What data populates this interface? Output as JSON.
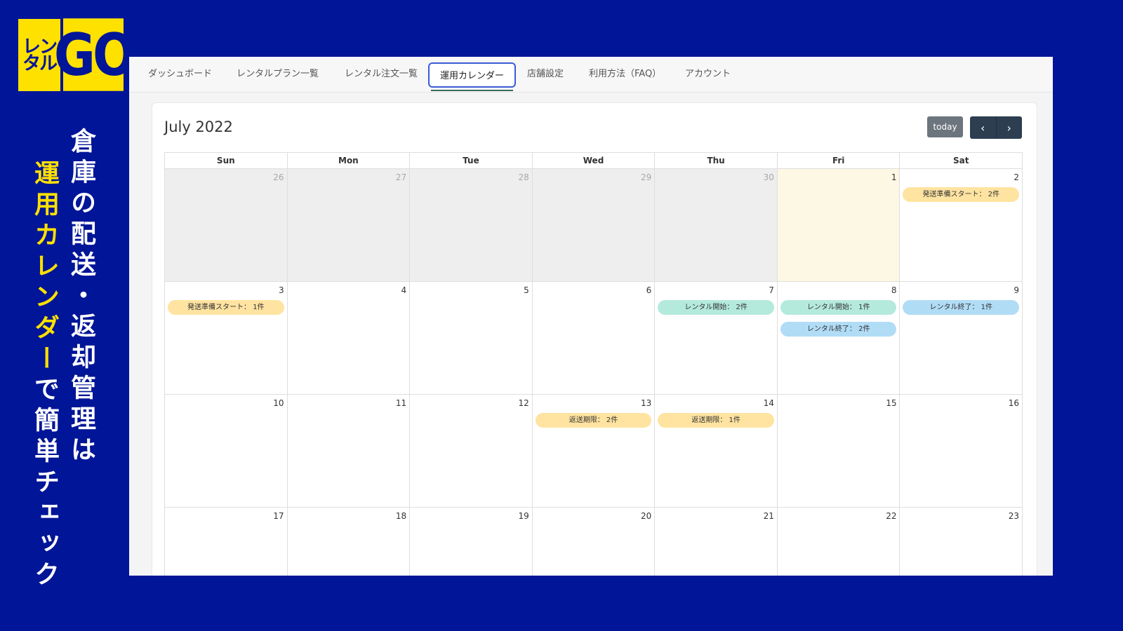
{
  "logo": {
    "left_line1": "レン",
    "left_line2": "タル",
    "right": "GO"
  },
  "tagline": {
    "line1": "倉庫の配送・返却管理は",
    "line2_highlight": "運用カレンダー",
    "line2_rest": "で簡単チェック"
  },
  "nav": {
    "tabs": [
      {
        "label": "ダッシュボード",
        "active": false
      },
      {
        "label": "レンタルプラン一覧",
        "active": false
      },
      {
        "label": "レンタル注文一覧",
        "active": false
      },
      {
        "label": "運用カレンダー",
        "active": true
      },
      {
        "label": "店舗設定",
        "active": false
      },
      {
        "label": "利用方法（FAQ）",
        "active": false
      },
      {
        "label": "アカウント",
        "active": false
      }
    ]
  },
  "calendar": {
    "title": "July 2022",
    "today_label": "today",
    "prev_icon": "chevron-left-icon",
    "next_icon": "chevron-right-icon",
    "weekdays": [
      "Sun",
      "Mon",
      "Tue",
      "Wed",
      "Thu",
      "Fri",
      "Sat"
    ],
    "weeks": [
      [
        {
          "day": "26",
          "other": true
        },
        {
          "day": "27",
          "other": true
        },
        {
          "day": "28",
          "other": true
        },
        {
          "day": "29",
          "other": true
        },
        {
          "day": "30",
          "other": true
        },
        {
          "day": "1",
          "today": true
        },
        {
          "day": "2",
          "events": [
            {
              "label": "発送準備スタート： 2件",
              "kind": "prep"
            }
          ]
        }
      ],
      [
        {
          "day": "3",
          "events": [
            {
              "label": "発送準備スタート： 1件",
              "kind": "prep"
            }
          ]
        },
        {
          "day": "4"
        },
        {
          "day": "5"
        },
        {
          "day": "6"
        },
        {
          "day": "7",
          "events": [
            {
              "label": "レンタル開始： 2件",
              "kind": "start"
            }
          ]
        },
        {
          "day": "8",
          "events": [
            {
              "label": "レンタル開始： 1件",
              "kind": "start"
            },
            {
              "label": "レンタル終了： 2件",
              "kind": "end"
            }
          ]
        },
        {
          "day": "9",
          "events": [
            {
              "label": "レンタル終了： 1件",
              "kind": "end"
            }
          ]
        }
      ],
      [
        {
          "day": "10"
        },
        {
          "day": "11"
        },
        {
          "day": "12"
        },
        {
          "day": "13",
          "events": [
            {
              "label": "返送期限： 2件",
              "kind": "due"
            }
          ]
        },
        {
          "day": "14",
          "events": [
            {
              "label": "返送期限： 1件",
              "kind": "due"
            }
          ]
        },
        {
          "day": "15"
        },
        {
          "day": "16"
        }
      ],
      [
        {
          "day": "17"
        },
        {
          "day": "18"
        },
        {
          "day": "19"
        },
        {
          "day": "20"
        },
        {
          "day": "21"
        },
        {
          "day": "22"
        },
        {
          "day": "23"
        }
      ]
    ]
  },
  "colors": {
    "background": "#001597",
    "accent_yellow": "#ffe100",
    "active_tab_border": "#3b5bd6",
    "today_bg": "#fcf8e3",
    "event_prep": "#ffe3a0",
    "event_start": "#b4eadb",
    "event_end": "#b1dcf6",
    "event_due": "#ffe3a0"
  }
}
